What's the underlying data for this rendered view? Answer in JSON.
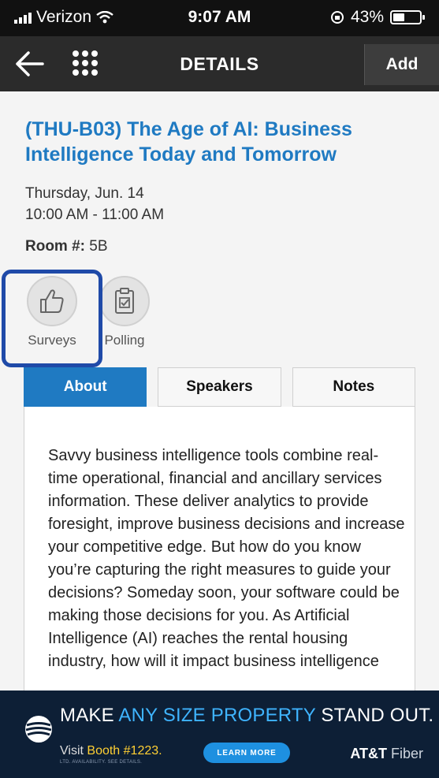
{
  "status_bar": {
    "carrier": "Verizon",
    "time": "9:07 AM",
    "battery_percent": "43%",
    "battery_level": 0.43
  },
  "nav": {
    "title": "DETAILS",
    "add_label": "Add",
    "icons": [
      "back-arrow-icon",
      "grid-menu-icon"
    ]
  },
  "session": {
    "title": "(THU-B03) The Age of AI: Business Intelligence Today and Tomorrow",
    "date": "Thursday, Jun. 14",
    "time": "10:00 AM - 11:00 AM",
    "room_label": "Room #:",
    "room_value": "5B"
  },
  "actions": [
    {
      "label": "Surveys",
      "icon": "thumbs-up-icon"
    },
    {
      "label": "Polling",
      "icon": "clipboard-check-icon"
    }
  ],
  "tabs": [
    {
      "label": "About",
      "active": true
    },
    {
      "label": "Speakers",
      "active": false
    },
    {
      "label": "Notes",
      "active": false
    }
  ],
  "about_text": "Savvy business intelligence tools combine real-time operational, financial and ancillary services information. These deliver analytics to provide foresight, improve business decisions and increase your competitive edge. But how do you know you’re capturing the right measures to guide your decisions? Someday soon, your software could be making those decisions for you. As Artificial Intelligence (AI) reaches the rental housing industry, how will it impact business intelligence",
  "ad": {
    "headline_pre": "MAKE ",
    "headline_highlight": "ANY SIZE PROPERTY",
    "headline_post": " STAND OUT.",
    "visit_pre": "Visit ",
    "visit_booth": "Booth #1223.",
    "fine_print": "LTD. AVAILABILITY. SEE DETAILS.",
    "button_label": "LEARN MORE",
    "brand_bold": "AT&T",
    "brand_light": " Fiber",
    "colors": {
      "background": "#0d1f36",
      "highlight": "#3fb4ff",
      "booth": "#ffcf33",
      "button": "#1e90e0"
    }
  },
  "colors": {
    "accent": "#1f7ac2",
    "highlight_box": "#1f4aa8",
    "navbar": "#2b2b2b"
  }
}
